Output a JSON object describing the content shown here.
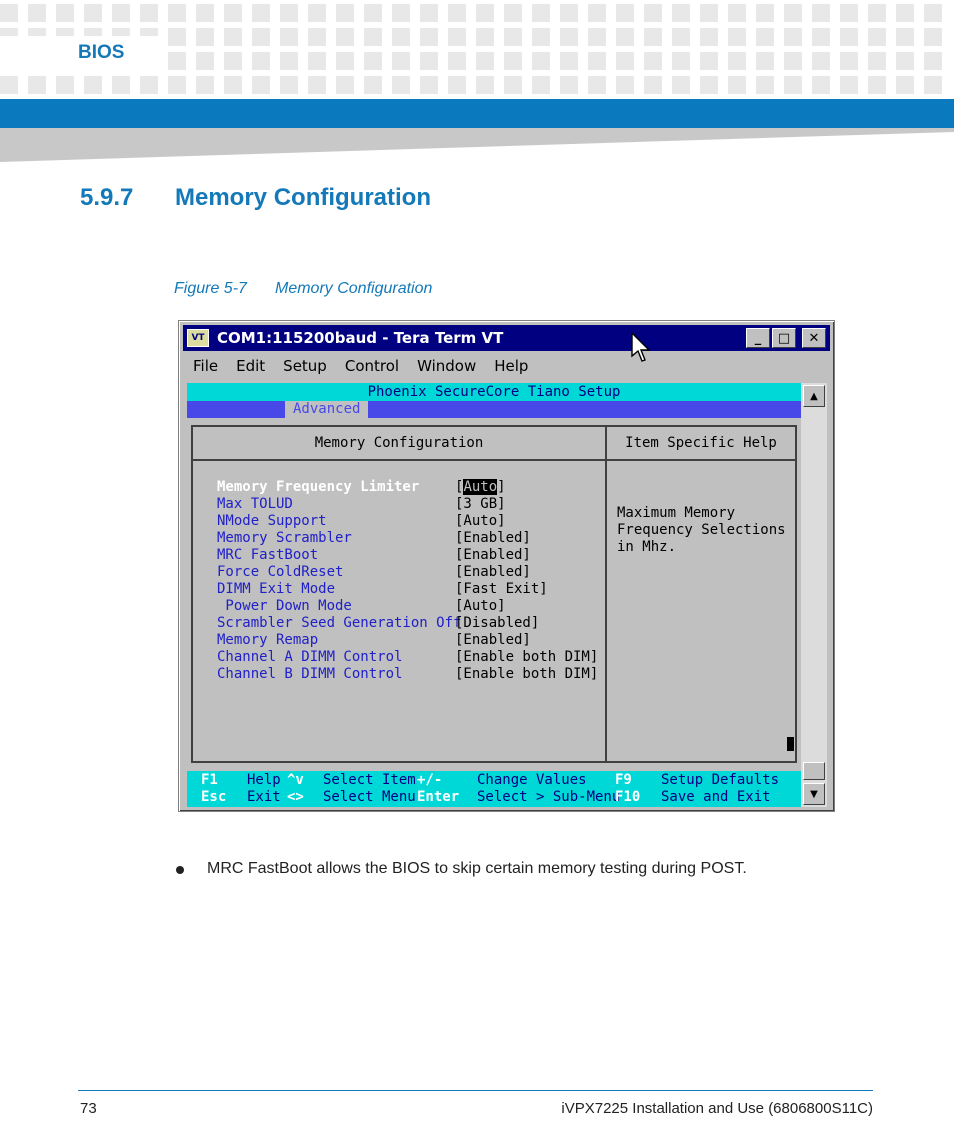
{
  "header": {
    "section_label": "BIOS"
  },
  "section": {
    "number": "5.9.7",
    "title": "Memory Configuration"
  },
  "figure": {
    "number": "Figure 5-7",
    "caption": "Memory Configuration"
  },
  "window": {
    "title": "COM1:115200baud - Tera Term VT",
    "logo_text": "VT",
    "buttons": {
      "minimize": "_",
      "maximize": "□",
      "close": "✕"
    },
    "menu": [
      "File",
      "Edit",
      "Setup",
      "Control",
      "Window",
      "Help"
    ]
  },
  "bios": {
    "app_title": "Phoenix SecureCore Tiano Setup",
    "active_tab": "Advanced",
    "panel_title": "Memory Configuration",
    "help_title": "Item Specific Help",
    "help_text": "Maximum Memory\nFrequency Selections\nin Mhz.",
    "items": [
      {
        "label": "Memory Frequency Limiter",
        "value_prefix": "[",
        "value_hi": "Auto",
        "value_suffix": "]",
        "selected": true
      },
      {
        "label": "Max TOLUD",
        "value": "[3 GB]"
      },
      {
        "label": "NMode Support",
        "value": "[Auto]"
      },
      {
        "label": "Memory Scrambler",
        "value": "[Enabled]"
      },
      {
        "label": "MRC FastBoot",
        "value": "[Enabled]"
      },
      {
        "label": "Force ColdReset",
        "value": "[Enabled]"
      },
      {
        "label": "DIMM Exit Mode",
        "value": "[Fast Exit]"
      },
      {
        "label": " Power Down Mode",
        "value": "[Auto]"
      },
      {
        "label": "Scrambler Seed Generation Off",
        "value": "[Disabled]"
      },
      {
        "label": "Memory Remap",
        "value": "[Enabled]"
      },
      {
        "label": "Channel A DIMM Control",
        "value": "[Enable both DIM]"
      },
      {
        "label": "Channel B DIMM Control",
        "value": "[Enable both DIM]"
      }
    ],
    "keys_row1": [
      {
        "key": "F1",
        "desc": "Help"
      },
      {
        "key": "^v",
        "desc": "Select Item"
      },
      {
        "key": "+/-",
        "desc": "Change Values"
      },
      {
        "key": "F9",
        "desc": "Setup Defaults"
      }
    ],
    "keys_row2": [
      {
        "key": "Esc",
        "desc": "Exit"
      },
      {
        "key": "<>",
        "desc": "Select Menu"
      },
      {
        "key": "Enter",
        "desc": "Select > Sub-Menu"
      },
      {
        "key": "F10",
        "desc": "Save and Exit"
      }
    ]
  },
  "bullet": "MRC FastBoot allows the BIOS to skip certain memory testing during POST.",
  "footer": {
    "page_number": "73",
    "doc_title": "iVPX7225 Installation and Use (6806800S11C)"
  },
  "colors": {
    "accent": "#1479b8",
    "band": "#0a79be",
    "title_bar": "#000080",
    "bios_cyan": "#00d8d8",
    "bios_blue": "#4848e8"
  }
}
